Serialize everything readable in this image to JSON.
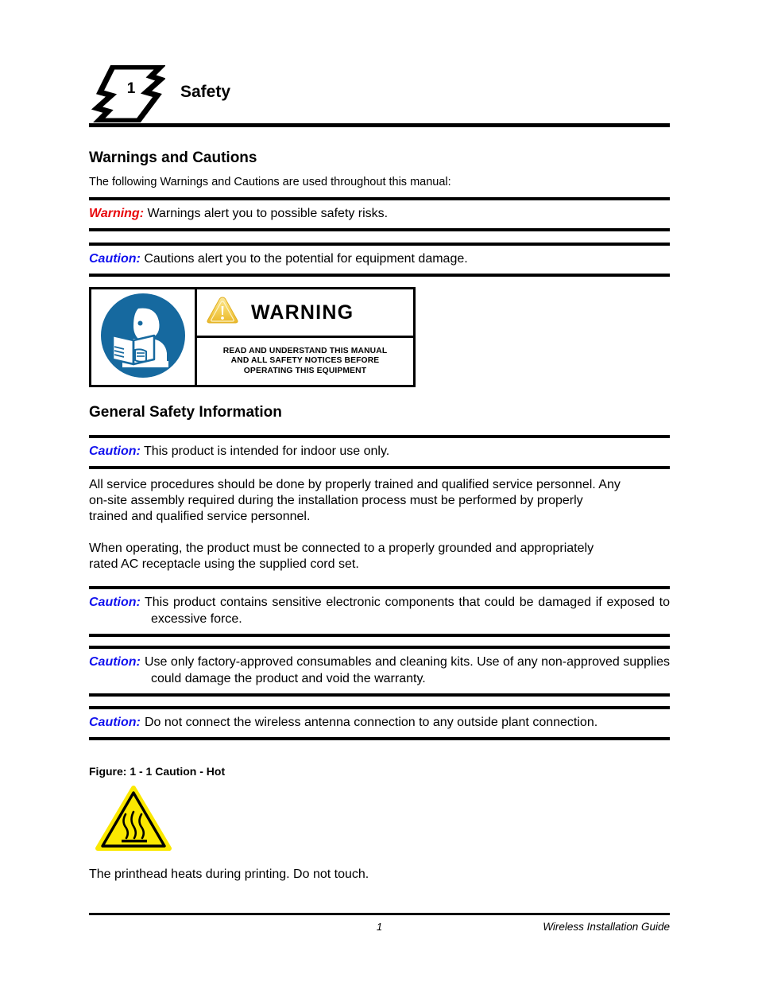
{
  "document": {
    "chapter_number": "1",
    "chapter_title": "Safety"
  },
  "sections": {
    "warnings_and_cautions": {
      "heading": "Warnings and Cautions",
      "intro": "The following Warnings and Cautions are used throughout this manual:",
      "alerts": [
        {
          "label": "Warning:",
          "label_color": "#e8070c",
          "text": "Warnings alert you to possible safety risks."
        },
        {
          "label": "Caution:",
          "label_color": "#1111ee",
          "text": "Cautions alert you to the potential for equipment damage."
        }
      ]
    },
    "warning_sign": {
      "icon_left": "read-manual-icon",
      "icon_triangle": "warning-triangle-icon",
      "title": "WARNING",
      "body": "READ AND UNDERSTAND THIS MANUAL AND ALL SAFETY NOTICES BEFORE OPERATING THIS EQUIPMENT",
      "body_line_1": "READ AND UNDERSTAND THIS MANUAL",
      "body_line_2": "AND ALL SAFETY NOTICES BEFORE",
      "body_line_3": "OPERATING THIS EQUIPMENT",
      "colors": {
        "circle_blue": "#16699f",
        "triangle_gold": "#f2c83c"
      }
    },
    "general_safety": {
      "heading": "General Safety Information",
      "indoor_caution": {
        "label": "Caution:",
        "label_color": "#1111ee",
        "text": "This product is intended for indoor use only."
      },
      "paragraphs": [
        "All service procedures should be done by properly trained and qualified service personnel. Any on-site assembly required during the installation process must be performed by properly trained and qualified service personnel.",
        "When operating, the product must be connected to a properly grounded and appropriately rated AC receptacle using the supplied cord set."
      ],
      "cautions": [
        {
          "label": "Caution:",
          "label_color": "#1111ee",
          "text": "This product contains sensitive electronic components that could be damaged if exposed to excessive force."
        },
        {
          "label": "Caution:",
          "label_color": "#1111ee",
          "text": "Use only factory-approved consumables and cleaning kits. Use of any non-approved supplies could damage the product and void the warranty."
        },
        {
          "label": "Caution:",
          "label_color": "#1111ee",
          "text": "Do not connect the wireless antenna connection to any outside plant connection."
        }
      ]
    },
    "figure": {
      "caption": "Figure: 1 - 1   Caution - Hot",
      "icon": "hot-surface-icon",
      "icon_color": "#fbe800",
      "description": "The printhead heats during printing. Do not touch."
    }
  },
  "footer": {
    "page_number": "1",
    "guide_title": "Wireless Installation Guide"
  }
}
